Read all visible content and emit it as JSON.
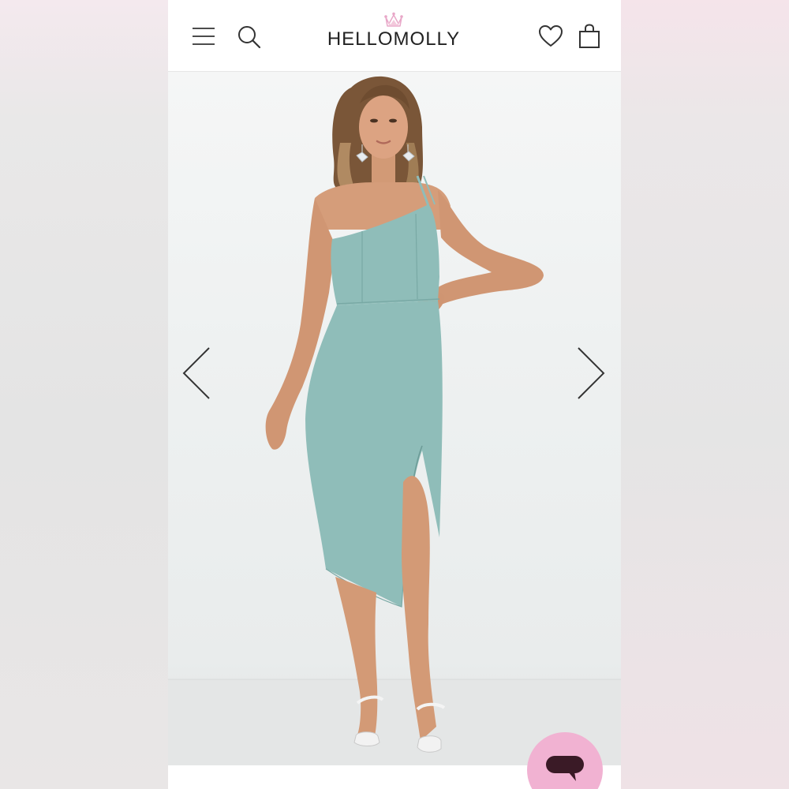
{
  "brand": {
    "name": "HELLOMOLLY",
    "crown_color": "#e8a7c8"
  },
  "header": {
    "menu_icon": "hamburger-menu-icon",
    "search_icon": "search-icon",
    "wishlist_icon": "heart-icon",
    "cart_icon": "shopping-bag-icon"
  },
  "gallery": {
    "prev_icon": "chevron-left-icon",
    "next_icon": "chevron-right-icon",
    "image": "product-photo",
    "dress_color": "#8fbdb9"
  },
  "chat": {
    "icon": "chat-bubble-icon",
    "button_color": "#f1b2d2",
    "icon_color": "#3a1a26"
  }
}
